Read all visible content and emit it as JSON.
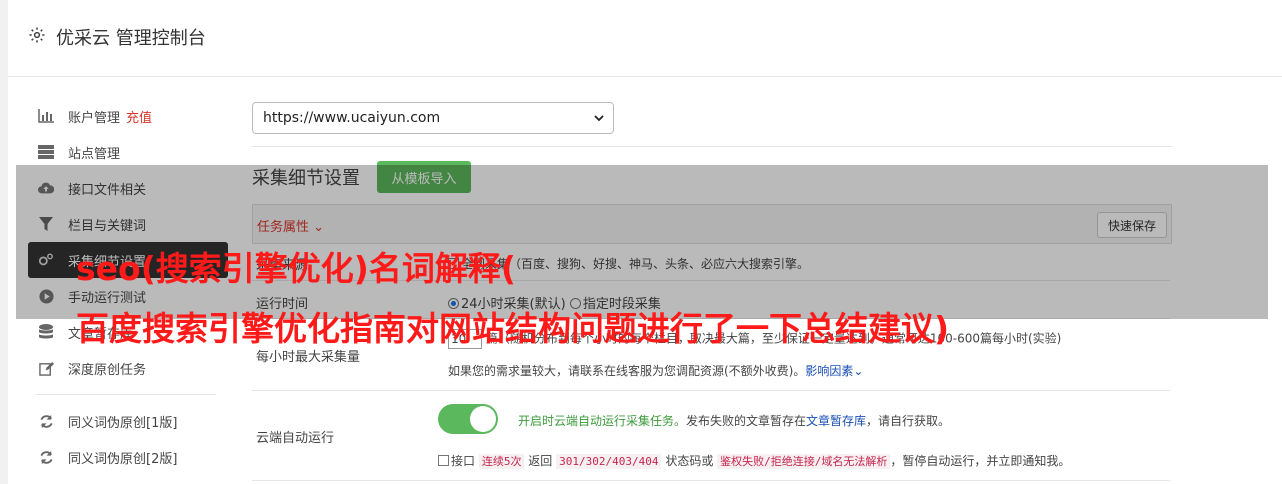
{
  "header": {
    "title": "优采云 管理控制台",
    "icon": "gear-icon"
  },
  "sidebar": {
    "items": [
      {
        "label": "账户管理",
        "badge": "充值",
        "icon": "bar-chart-icon"
      },
      {
        "label": "站点管理",
        "icon": "server-icon"
      },
      {
        "label": "接口文件相关",
        "icon": "cloud-upload-icon"
      },
      {
        "label": "栏目与关键词",
        "icon": "filter-icon"
      },
      {
        "label": "采集细节设置",
        "icon": "cogs-icon",
        "active": true
      },
      {
        "label": "手动运行测试",
        "icon": "play-circle-icon"
      },
      {
        "label": "文章暂存库",
        "icon": "database-icon"
      },
      {
        "label": "深度原创任务",
        "icon": "edit-icon"
      }
    ],
    "items2": [
      {
        "label": "同义词伪原创[1版]",
        "icon": "refresh-icon"
      },
      {
        "label": "同义词伪原创[2版]",
        "icon": "refresh-icon"
      }
    ]
  },
  "site_select": {
    "value": "https://www.ucaiyun.com"
  },
  "section": {
    "title": "采集细节设置",
    "import_button": "从模板导入"
  },
  "panel": {
    "tab_label": "任务属性",
    "save_button": "快速保存",
    "scope_label": "采集来源",
    "scope_text": "全网采集（百度、搜狗、好搜、神马、头条、必应六大搜索引擎。",
    "runtime_label": "运行时间",
    "runtime_opt1": "24小时采集(默认)",
    "runtime_opt2": "指定时段采集",
    "max_label": "每小时最大采集量",
    "max_value": "10",
    "max_text_a": "篇（随机分布到每个小时的每个栏目，取决最大篇，至少保证一定量达到，通常可达100-600篇每小时(实验)",
    "max_text_b": "如果您的需求量较大，请联系在线客服为您调配资源(不额外收费)。",
    "max_link": "影响因素",
    "cloud_label": "云端自动运行",
    "cloud_text_green": "开启时云端自动运行采集任务。",
    "cloud_text_a": "发布失败的文章暂存在",
    "cloud_link": "文章暂存库",
    "cloud_text_b": "，请自行获取。",
    "iface_a": "接口",
    "iface_code1": "连续5次",
    "iface_b": "返回",
    "iface_code2": "301/302/403/404",
    "iface_c": "状态码或",
    "iface_code3": "鉴权失败/拒绝连接/域名无法解析",
    "iface_d": "，暂停自动运行，并立即通知我。"
  },
  "overlay": {
    "line1": "seo(搜索引擎优化)名词解释(",
    "line2": "百度搜索引擎优化指南对网站结构问题进行了一下总结建议)"
  },
  "colors": {
    "accent_green": "#5cb85c",
    "red": "#d9362b",
    "link": "#1a4fb4"
  }
}
